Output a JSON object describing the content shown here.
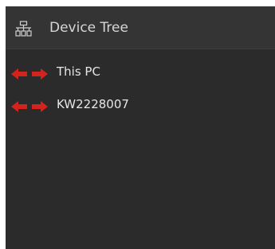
{
  "header": {
    "title": "Device Tree",
    "icon": "device-tree-icon"
  },
  "tree": {
    "items": [
      {
        "label": "This PC",
        "icon": "connection-arrows-icon"
      },
      {
        "label": "KW2228007",
        "icon": "connection-arrows-icon"
      }
    ]
  },
  "colors": {
    "panel_bg": "#2b2b2b",
    "header_bg": "#343434",
    "text": "#e6e6e6",
    "arrow_red": "#d4231c"
  }
}
